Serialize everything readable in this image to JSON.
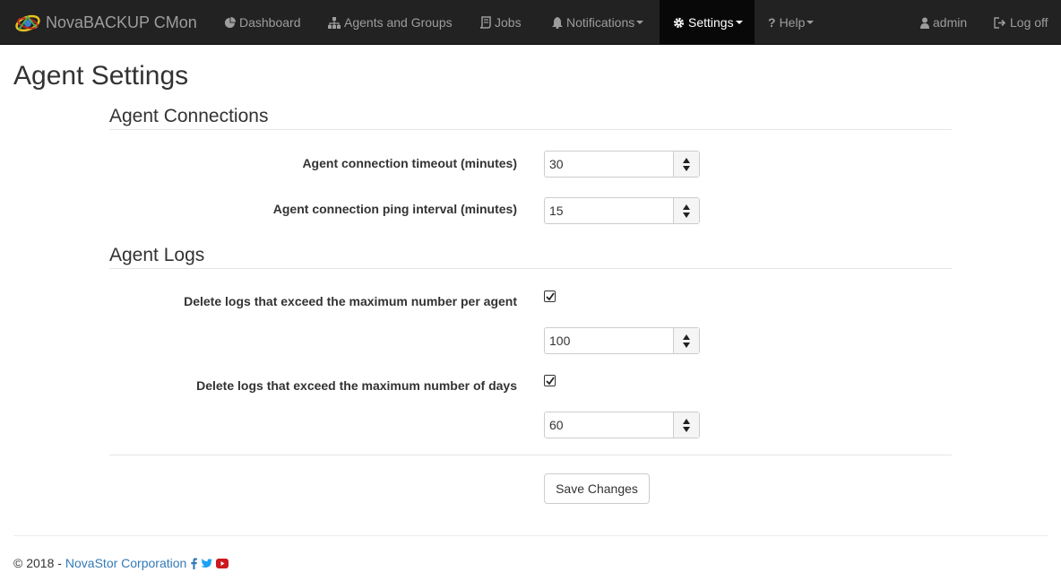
{
  "nav": {
    "brand": "NovaBACKUP CMon",
    "items": [
      {
        "label": "Dashboard",
        "icon": "pie-chart-icon"
      },
      {
        "label": "Agents and Groups",
        "icon": "sitemap-icon"
      },
      {
        "label": "Jobs",
        "icon": "script-icon"
      },
      {
        "label": "Notifications",
        "icon": "bell-icon"
      },
      {
        "label": "Settings",
        "icon": "cog-icon"
      },
      {
        "label": "Help",
        "icon": "question-icon"
      }
    ],
    "user": "admin",
    "logoff": "Log off"
  },
  "page": {
    "title": "Agent Settings"
  },
  "connections": {
    "heading": "Agent Connections",
    "timeout_label": "Agent connection timeout (minutes)",
    "timeout_value": "30",
    "ping_label": "Agent connection ping interval (minutes)",
    "ping_value": "15"
  },
  "logs": {
    "heading": "Agent Logs",
    "per_agent_label": "Delete logs that exceed the maximum number per agent",
    "per_agent_checked": true,
    "per_agent_value": "100",
    "days_label": "Delete logs that exceed the maximum number of days",
    "days_checked": true,
    "days_value": "60"
  },
  "actions": {
    "save": "Save Changes"
  },
  "footer": {
    "copyright": "© 2018 -",
    "company": "NovaStor Corporation"
  },
  "colors": {
    "navbar": "#222222",
    "link": "#337ab7",
    "twitter": "#1da1f2",
    "youtube": "#cc181e"
  }
}
